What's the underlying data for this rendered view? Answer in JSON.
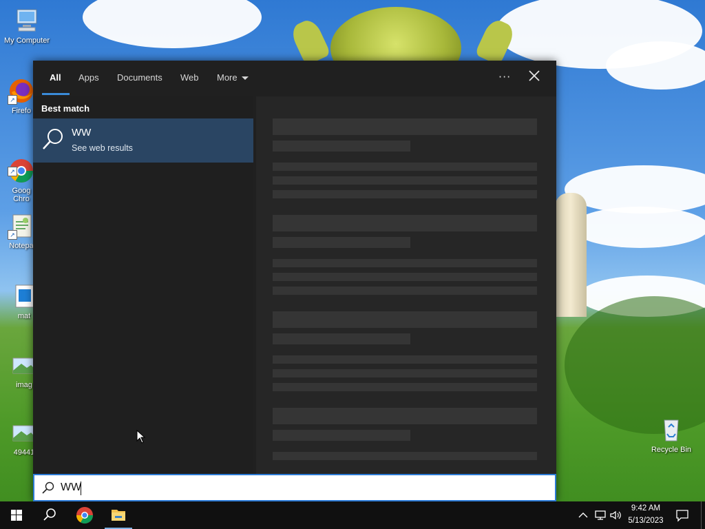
{
  "desktop": {
    "icons": [
      {
        "label": "My Computer"
      },
      {
        "label": "Firefo"
      },
      {
        "label": "Goog\nChro"
      },
      {
        "label": "Notepa"
      },
      {
        "label": "mat"
      },
      {
        "label": "imag"
      },
      {
        "label": "49441"
      },
      {
        "label": "Recycle Bin"
      }
    ]
  },
  "search": {
    "tabs": [
      "All",
      "Apps",
      "Documents",
      "Web",
      "More"
    ],
    "active_tab": "All",
    "best_match_label": "Best match",
    "result": {
      "title": "WW",
      "subtitle": "See web results",
      "icon": "search-icon"
    },
    "input_value": "WW"
  },
  "taskbar": {
    "time": "9:42 AM",
    "date": "5/13/2023",
    "pinned": [
      "start-icon",
      "search-icon",
      "chrome-icon",
      "file-explorer-icon"
    ]
  },
  "colors": {
    "accent": "#3a8bd8",
    "selected_result": "#2a4563",
    "panel_bg": "#202020",
    "taskbar_bg": "#101010"
  }
}
